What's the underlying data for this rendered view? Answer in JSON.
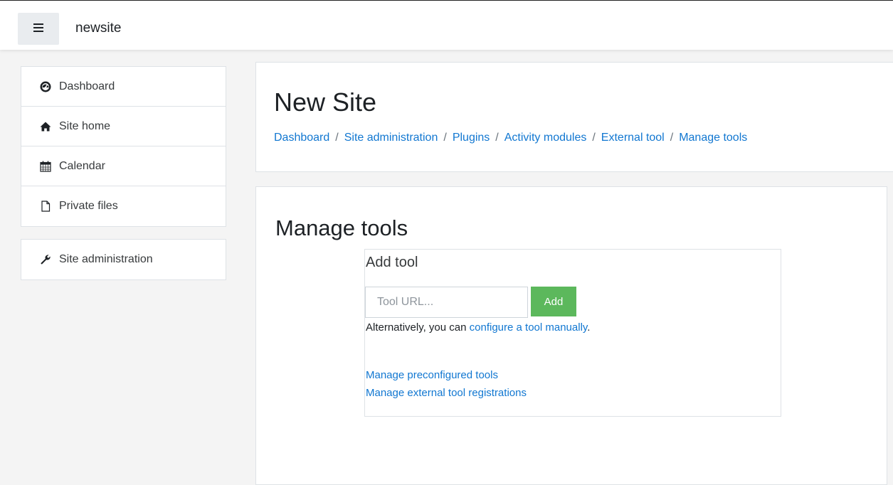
{
  "topbar": {
    "menu_icon": "hamburger-icon",
    "site_name": "newsite"
  },
  "sidebar": {
    "items": [
      {
        "label": "Dashboard",
        "icon": "dashboard-icon"
      },
      {
        "label": "Site home",
        "icon": "home-icon"
      },
      {
        "label": "Calendar",
        "icon": "calendar-icon"
      },
      {
        "label": "Private files",
        "icon": "file-icon"
      }
    ],
    "admin": {
      "label": "Site administration",
      "icon": "wrench-icon"
    }
  },
  "header": {
    "title": "New Site",
    "breadcrumbs": [
      "Dashboard",
      "Site administration",
      "Plugins",
      "Activity modules",
      "External tool",
      "Manage tools"
    ],
    "separator": "/"
  },
  "main": {
    "title": "Manage tools",
    "add_tool": {
      "title": "Add tool",
      "url_placeholder": "Tool URL...",
      "add_label": "Add",
      "alt_prefix": "Alternatively, you can ",
      "alt_link": "configure a tool manually",
      "alt_suffix": "."
    },
    "links": [
      "Manage preconfigured tools",
      "Manage external tool registrations"
    ]
  },
  "colors": {
    "link": "#1177d1",
    "add_button": "#5cb85c",
    "background": "#f4f4f4"
  }
}
